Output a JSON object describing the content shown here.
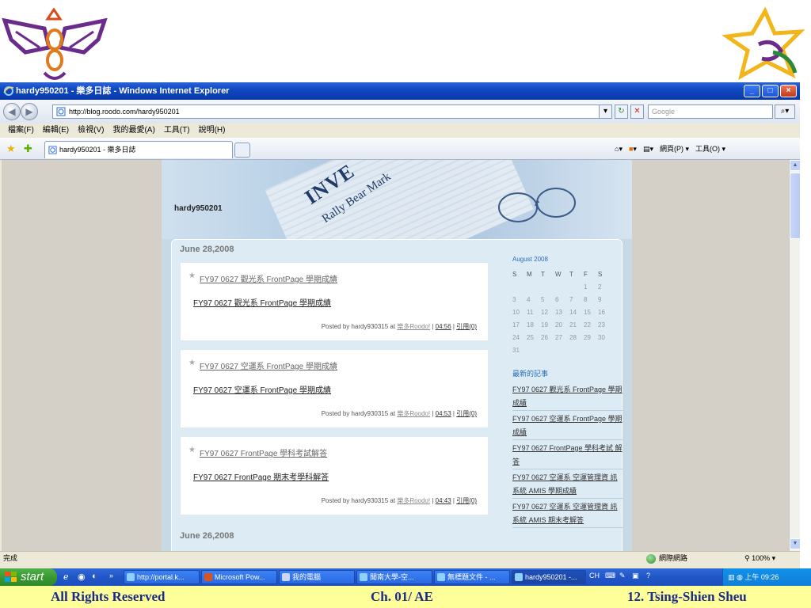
{
  "window": {
    "title": "hardy950201 - 樂多日誌 - Windows Internet Explorer",
    "controls": [
      "_",
      "□",
      "×"
    ]
  },
  "address_bar": {
    "url": "http://blog.roodo.com/hardy950201",
    "search_placeholder": "Google"
  },
  "menu": [
    "檔案(F)",
    "編輯(E)",
    "檢視(V)",
    "我的最愛(A)",
    "工具(T)",
    "說明(H)"
  ],
  "tab": {
    "label": "hardy950201 - 樂多日誌"
  },
  "command_bar": [
    "▾",
    "▾",
    "▾",
    "網頁(P) ▾",
    "工具(O) ▾"
  ],
  "blog": {
    "title": "hardy950201",
    "sections": [
      {
        "date": "June 28,2008",
        "posts": [
          {
            "title": "FY97 0627 觀光系 FrontPage 學期成績",
            "body": "FY97 0627 觀光系 FrontPage 學期成績",
            "posted_by": "Posted by hardy930315 at",
            "site_link": "樂多Roodo!",
            "time": "04:56",
            "ref": "引用(0)"
          },
          {
            "title": "FY97 0627 空運系 FrontPage 學期成績",
            "body": "FY97 0627 空運系 FrontPage 學期成績",
            "posted_by": "Posted by hardy930315 at",
            "site_link": "樂多Roodo!",
            "time": "04:53",
            "ref": "引用(0)"
          },
          {
            "title": "FY97 0627 FrontPage 學科考試解答",
            "body": "FY97 0627 FrontPage 期末考學科解答",
            "posted_by": "Posted by hardy930315 at",
            "site_link": "樂多Roodo!",
            "time": "04:43",
            "ref": "引用(0)"
          }
        ]
      },
      {
        "date": "June 26,2008",
        "posts": []
      }
    ],
    "calendar": {
      "month": "August 2008",
      "weekdays": [
        "S",
        "M",
        "T",
        "W",
        "T",
        "F",
        "S"
      ],
      "days": [
        "",
        "",
        "",
        "",
        "",
        "1",
        "2",
        "3",
        "4",
        "5",
        "6",
        "7",
        "8",
        "9",
        "10",
        "11",
        "12",
        "13",
        "14",
        "15",
        "16",
        "17",
        "18",
        "19",
        "20",
        "21",
        "22",
        "23",
        "24",
        "25",
        "26",
        "27",
        "28",
        "29",
        "30",
        "31"
      ]
    },
    "recent": {
      "heading": "最新的記事",
      "items": [
        "FY97 0627 觀光系 FrontPage 學期成績",
        "FY97 0627 空運系 FrontPage 學期成績",
        "FY97 0627 FrontPage 學科考試 解答",
        "FY97 0627 空運系 空運管理資 訊系統 AMIS 學期成績",
        "FY97 0627 空運系 空運管理資 訊系統 AMIS 期末考解答"
      ]
    }
  },
  "status_bar": {
    "text": "完成",
    "zone": "網際網路",
    "zoom": "100%"
  },
  "taskbar": {
    "start": "start",
    "tasks": [
      {
        "label": "http://portal.k...",
        "color": "#2a6ae5"
      },
      {
        "label": "Microsoft Pow...",
        "color": "#d9531e"
      },
      {
        "label": "我的電腦",
        "color": "#6d8fd6"
      },
      {
        "label": "聞南大學-空...",
        "color": "#2a6ae5"
      },
      {
        "label": "無標題文件 - ...",
        "color": "#2a6ae5"
      },
      {
        "label": "hardy950201 -...",
        "color": "#2a6ae5"
      }
    ],
    "ime": "CH",
    "clock": "上午 09:26"
  },
  "footer": {
    "left": "All Rights Reserved",
    "center": "Ch. 01/ AE",
    "right": "12. Tsing-Shien Sheu"
  },
  "colors": {
    "title_bar": "#0b3cad",
    "footer_bg": "#ffff99",
    "footer_text": "#1a2a8c",
    "link_blue": "#2a6db5"
  }
}
